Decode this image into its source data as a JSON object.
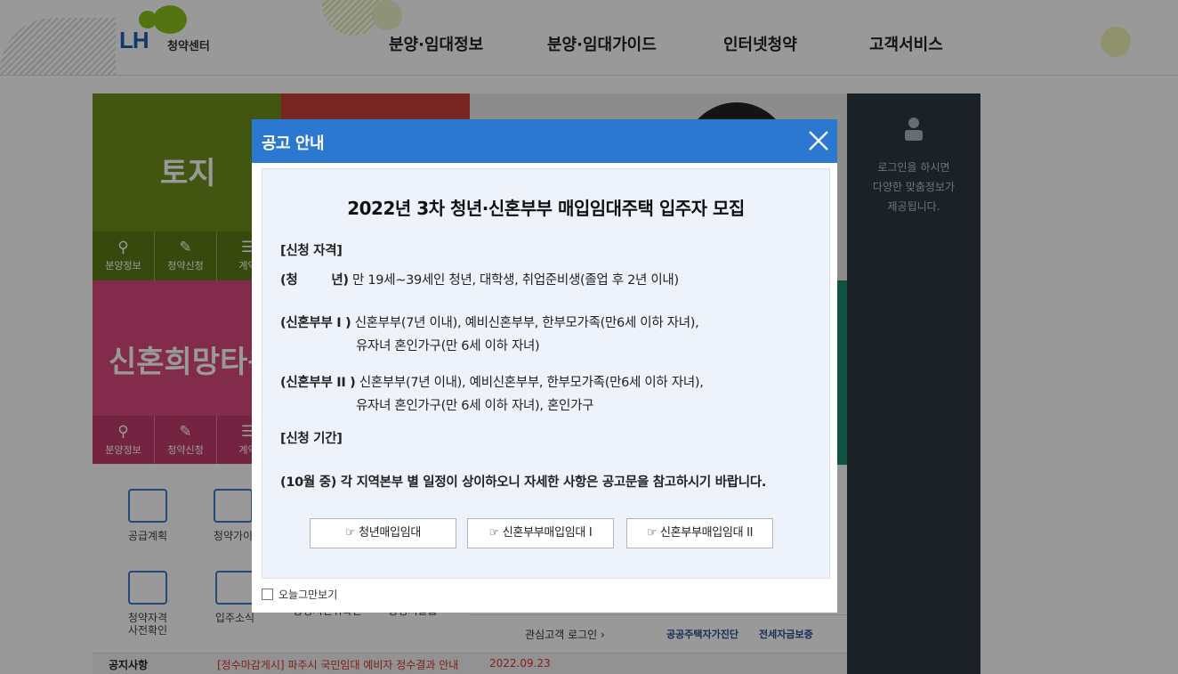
{
  "header": {
    "logo_text": "LH",
    "logo_sub": "청약센터",
    "nav": [
      "분양·임대정보",
      "분양·임대가이드",
      "인터넷청약",
      "고객서비스"
    ]
  },
  "tiles": {
    "land_label": "토지",
    "newlywed_label": "신혼희망타운",
    "icons": [
      "분양정보",
      "청약신청",
      "계약"
    ],
    "icon_names": [
      "search-icon",
      "pen-icon",
      "list-icon"
    ]
  },
  "side_panel": {
    "login_message": "로그인을 하시면\n다양한 맞춤정보가\n제공됩니다."
  },
  "quick": {
    "items": [
      "공급계획",
      "청약가이",
      "청약자격\n사전확인",
      "입주소식",
      "증명서진위확인",
      "증명서발급"
    ]
  },
  "bottom": {
    "notice_label": "공지사항",
    "notice_text": "[정수마감게시] 파주시 국민임대 예비자 정수결과 안내",
    "notice_date": "2022.09.23",
    "interest_login": "관심고객 로그인",
    "partner1": "공공주택자가진단",
    "partner2": "전세자금보증"
  },
  "modal": {
    "title": "공고 안내",
    "notice_title": "2022년 3차 청년·신혼부부 매입임대주택 입주자 모집",
    "qualification_header": "[신청 자격]",
    "youth_label": "(청        년)",
    "youth_text": "만 19세~39세인 청년, 대학생, 취업준비생(졸업 후 2년 이내)",
    "newlywed1_label": "(신혼부부 I )",
    "newlywed1_text": "신혼부부(7년 이내), 예비신혼부부, 한부모가족(만6세 이하 자녀),",
    "newlywed1_cont": "유자녀 혼인가구(만 6세 이하 자녀)",
    "newlywed2_label": "(신혼부부 II )",
    "newlywed2_text": "신혼부부(7년 이내), 예비신혼부부, 한부모가족(만6세 이하 자녀),",
    "newlywed2_cont": "유자녀 혼인가구(만 6세 이하 자녀), 혼인가구",
    "period_header": "[신청 기간]",
    "period_text": "(10월 중) 각 지역본부 별 일정이 상이하오니 자세한 사항은 공고문을 참고하시기 바랍니다.",
    "buttons": [
      "☞ 청년매입임대",
      "☞ 신혼부부매입임대 I",
      "☞ 신혼부부매입임대 II"
    ],
    "today_hide": "오늘그만보기"
  },
  "colors": {
    "modal_header": "#2b78d0",
    "modal_body": "#eef2fa",
    "land_tile": "#6e8f1d",
    "newlywed_tile": "#d9487e",
    "side_panel": "#2f3844"
  }
}
